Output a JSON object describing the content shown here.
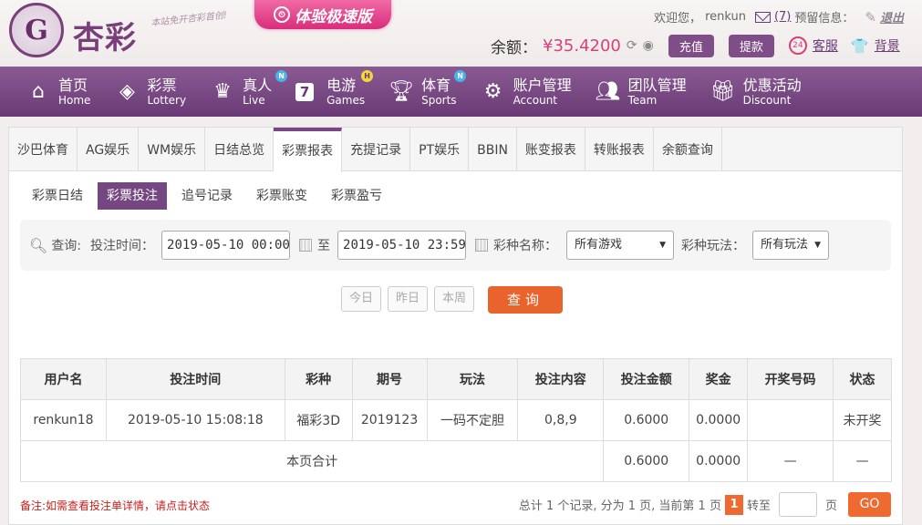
{
  "brand": {
    "logo_text": "杏彩",
    "slogan": "本站免开杏彩首创!",
    "promo": "体验极速版"
  },
  "header": {
    "welcome": "欢迎您，",
    "username": "renkun",
    "mail_count": "(7)",
    "reserve_info": "预留信息：",
    "logout": "退出",
    "balance_label": "余额：",
    "balance_value": "¥35.4200",
    "deposit": "充值",
    "withdraw": "提款",
    "service": "客服",
    "theme": "背景"
  },
  "nav": [
    {
      "cn": "首页",
      "en": "Home",
      "icon": "home-icon",
      "badge": ""
    },
    {
      "cn": "彩票",
      "en": "Lottery",
      "icon": "ticket-icon",
      "badge": ""
    },
    {
      "cn": "真人",
      "en": "Live",
      "icon": "live-icon",
      "badge": "N"
    },
    {
      "cn": "电游",
      "en": "Games",
      "icon": "games-icon",
      "badge": "H"
    },
    {
      "cn": "体育",
      "en": "Sports",
      "icon": "trophy-icon",
      "badge": "N"
    },
    {
      "cn": "账户管理",
      "en": "Account",
      "icon": "account-icon",
      "badge": ""
    },
    {
      "cn": "团队管理",
      "en": "Team",
      "icon": "team-icon",
      "badge": ""
    },
    {
      "cn": "优惠活动",
      "en": "Discount",
      "icon": "gift-icon",
      "badge": ""
    }
  ],
  "tabs": [
    "沙巴体育",
    "AG娱乐",
    "WM娱乐",
    "日结总览",
    "彩票报表",
    "充提记录",
    "PT娱乐",
    "BBIN",
    "账变报表",
    "转账报表",
    "余额查询"
  ],
  "subtabs": [
    "彩票日结",
    "彩票投注",
    "追号记录",
    "彩票账变",
    "彩票盈亏"
  ],
  "filter": {
    "query_label": "查询:",
    "time_label": "投注时间：",
    "start": "2019-05-10 00:00:00",
    "to": "至",
    "end": "2019-05-10 23:59:59",
    "game_label": "彩种名称：",
    "game_value": "所有游戏",
    "play_label": "彩种玩法：",
    "play_value": "所有玩法"
  },
  "quick": {
    "today": "今日",
    "yesterday": "昨日",
    "week": "本周",
    "search": "查询"
  },
  "table": {
    "headers": [
      "用户名",
      "投注时间",
      "彩种",
      "期号",
      "玩法",
      "投注内容",
      "投注金额",
      "奖金",
      "开奖号码",
      "状态"
    ],
    "rows": [
      [
        "renkun18",
        "2019-05-10 15:08:18",
        "福彩3D",
        "2019123",
        "一码不定胆",
        "0,8,9",
        "0.6000",
        "0.0000",
        "",
        "未开奖"
      ]
    ],
    "summary": {
      "label": "本页合计",
      "amount": "0.6000",
      "prize": "0.0000",
      "draw": "—",
      "status": "—"
    }
  },
  "note": "备注:如需查看投注单详情，请点击状态",
  "pager": {
    "summary": "总计 1 个记录, 分为 1 页, 当前第 1 页",
    "current": "1",
    "goto": "转至",
    "page_unit": "页",
    "go": "GO"
  }
}
